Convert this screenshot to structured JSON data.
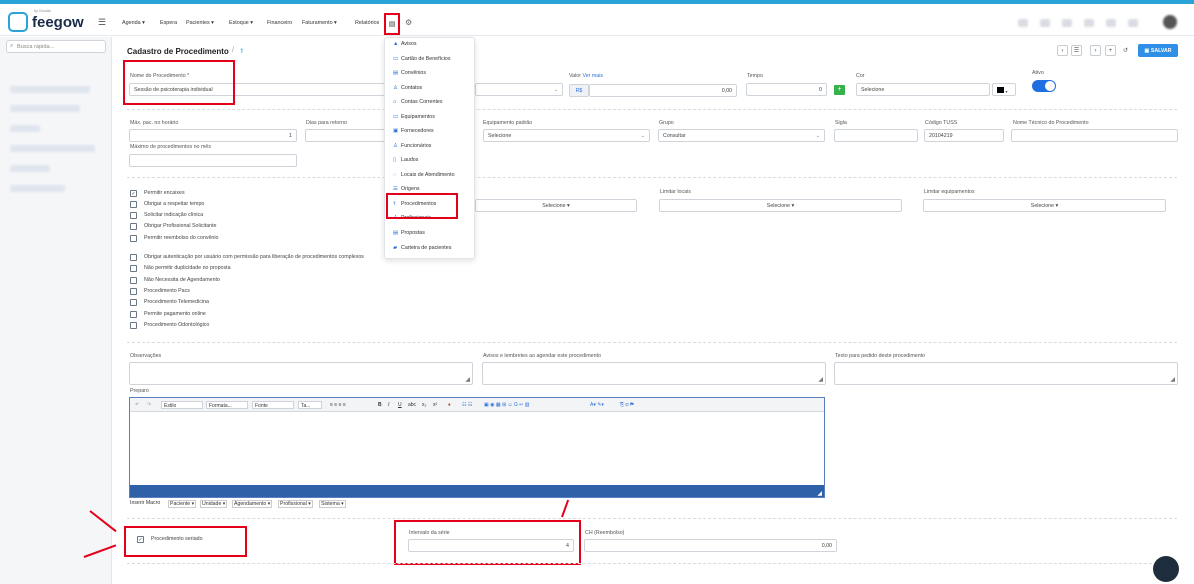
{
  "topbar": {
    "brand": "feegow",
    "brand_tag": "by Cloudia",
    "nav": [
      "Agenda ▾",
      "Espera",
      "Pacientes ▾",
      "Estoque ▾",
      "Financeiro",
      "Faturamento ▾",
      "Relatórios"
    ]
  },
  "sidebar": {
    "search_placeholder": "Busca rápida..."
  },
  "header": {
    "title": "Cadastro de Procedimento",
    "save_label": "SALVAR"
  },
  "form": {
    "nome_label": "Nome do Procedimento *",
    "nome_value": "Sessão de psicoterapia individual",
    "valor_label": "Valor",
    "ver_mais": "Ver mais",
    "currency": "R$",
    "valor_value": "0,00",
    "tempo_label": "Tempo",
    "tempo_value": "0",
    "cor_label": "Cor",
    "cor_value": "Selecione",
    "ativo_label": "Ativo",
    "max_pac_label": "Máx. pac. no horário",
    "max_pac_value": "1",
    "dias_retorno_label": "Dias para retorno",
    "equip_padrao_label": "Equipamento padrão",
    "equip_padrao_value": "Selecione",
    "grupo_label": "Grupo",
    "grupo_value": "Consultar",
    "sigla_label": "Sigla",
    "tuss_label": "Código TUSS",
    "tuss_value": "20104219",
    "nome_tecnico_label": "Nome Técnico do Procedimento",
    "max_mes_label": "Máximo de procedimentos no mês",
    "limitar_locais_label": "Limitar locais",
    "limitar_locais_value": "Selecione ▾",
    "limitar_equip_label": "Limitar equipamentos",
    "limitar_equip_value": "Selecione ▾",
    "hidden_select_value": "Selecione ▾",
    "observacoes_label": "Observações",
    "avisos_label": "Avisos e lembretes ao agendar este procedimento",
    "texto_pedido_label": "Texto para pedido deste procedimento",
    "preparo_label": "Preparo",
    "seriado_label": "Procedimento seriado",
    "intervalo_label": "Intervalo da série",
    "intervalo_value": "4",
    "ch_label": "CH (Reembolso)",
    "ch_value": "0,00"
  },
  "checkboxes": [
    {
      "label": "Permitir encaixes",
      "checked": true
    },
    {
      "label": "Obrigar a respeitar tempo",
      "checked": false
    },
    {
      "label": "Solicitar indicação clínica",
      "checked": false
    },
    {
      "label": "Obrigar Profissional Solicitante",
      "checked": false
    },
    {
      "label": "Permitir reembolso do convênio",
      "checked": false
    },
    {
      "label": "Obrigar autenticação por usuário com permissão para liberação de procedimentos complexos",
      "checked": false
    },
    {
      "label": "Não permitir duplicidade no proposta",
      "checked": false
    },
    {
      "label": "Não Necessita de Agendamento",
      "checked": false
    },
    {
      "label": "Procedimento Pacs",
      "checked": false
    },
    {
      "label": "Procedimento Telemedicina",
      "checked": false
    },
    {
      "label": "Permite pagamento online",
      "checked": false
    },
    {
      "label": "Procedimento Odontológico",
      "checked": false
    }
  ],
  "dropdown": {
    "items": [
      {
        "label": "Avisos",
        "icon": "▲"
      },
      {
        "label": "Cartão de Benefícios",
        "icon": "▭"
      },
      {
        "label": "Convênios",
        "icon": "▤"
      },
      {
        "label": "Contatos",
        "icon": "♙"
      },
      {
        "label": "Contas Correntes",
        "icon": "⌂"
      },
      {
        "label": "Equipamentos",
        "icon": "▭"
      },
      {
        "label": "Fornecedores",
        "icon": "▣"
      },
      {
        "label": "Funcionários",
        "icon": "♙"
      },
      {
        "label": "Laudos",
        "icon": "▯"
      },
      {
        "label": "Locais de Atendimento",
        "icon": "◌"
      },
      {
        "label": "Origens",
        "icon": "☰"
      },
      {
        "label": "Procedimentos",
        "icon": "⚕"
      },
      {
        "label": "Profissionais",
        "icon": "♙"
      },
      {
        "label": "Propostas",
        "icon": "▤"
      },
      {
        "label": "Carteira de pacientes",
        "icon": "▰"
      }
    ]
  },
  "editor": {
    "style": "Estilo",
    "format": "Formata...",
    "font": "Fonte",
    "size": "Ta..."
  },
  "macro": {
    "label": "Inserir Macro",
    "items": [
      "Paciente ▾",
      "Unidade ▾",
      "Agendamento ▾",
      "Profissional ▾",
      "Sistema ▾"
    ]
  }
}
